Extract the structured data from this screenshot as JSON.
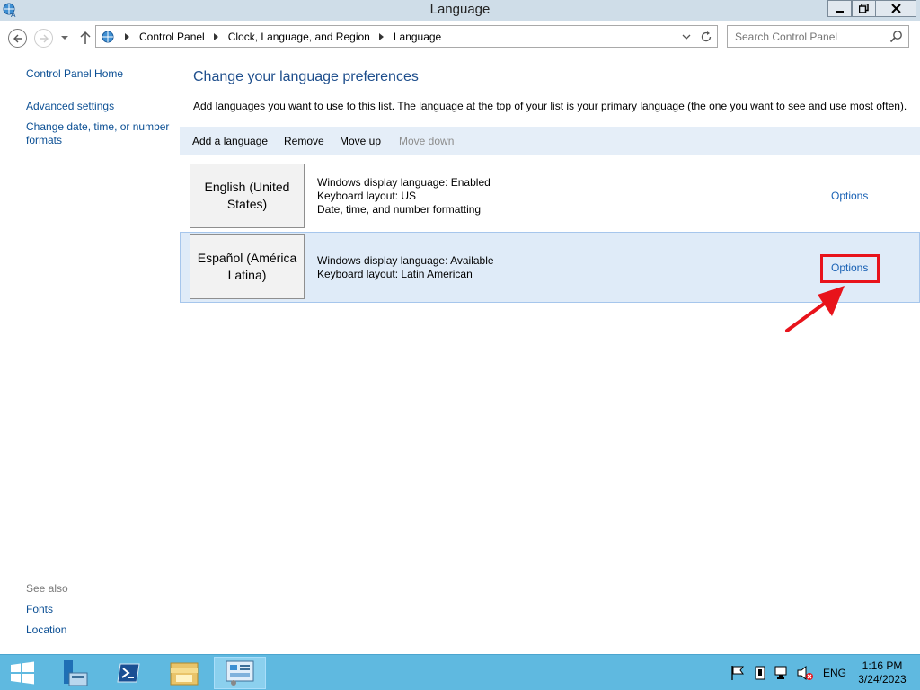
{
  "window": {
    "title": "Language"
  },
  "nav": {
    "breadcrumbs": [
      "Control Panel",
      "Clock, Language, and Region",
      "Language"
    ],
    "search_placeholder": "Search Control Panel"
  },
  "left_pane": {
    "home": "Control Panel Home",
    "links": [
      "Advanced settings",
      "Change date, time, or number",
      "formats"
    ],
    "see_also": "See also",
    "see_also_links": [
      "Fonts",
      "Location"
    ]
  },
  "main": {
    "heading": "Change your language preferences",
    "description": "Add languages you want to use to this list. The language at the top of your list is your primary language (the one you want to see and use most often).",
    "toolbar": [
      "Add a language",
      "Remove",
      "Move up",
      "Move down"
    ],
    "languages": [
      {
        "name_line1": "English (United",
        "name_line2": "States)",
        "details": [
          "Windows display language: Enabled",
          "Keyboard layout: US",
          "Date, time, and number formatting"
        ],
        "options": "Options"
      },
      {
        "name_line1": "Español (América",
        "name_line2": "Latina)",
        "details": [
          "Windows display language: Available",
          "Keyboard layout: Latin American"
        ],
        "options": "Options"
      }
    ]
  },
  "taskbar": {
    "lang_indicator": "ENG",
    "time": "1:16 PM",
    "date": "3/24/2023"
  },
  "colors": {
    "link": "#1a62b5",
    "heading": "#1e4e8c",
    "highlight": "#e8131b",
    "taskbar": "#5fb9e0",
    "selected_row": "#dfebf8"
  }
}
